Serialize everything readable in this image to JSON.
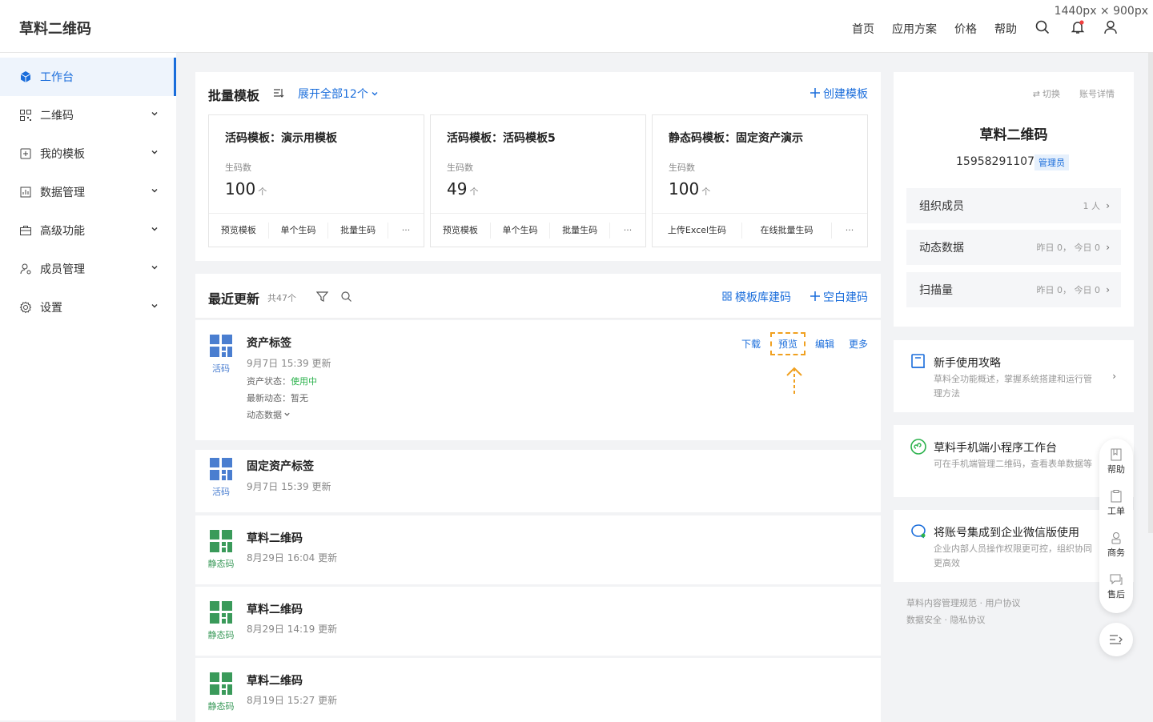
{
  "page_size_label": "1440px × 900px",
  "header": {
    "logo": "草料二维码",
    "nav": [
      "首页",
      "应用方案",
      "价格",
      "帮助"
    ]
  },
  "sidebar": {
    "items": [
      {
        "label": "工作台",
        "icon": "cube-icon",
        "active": true
      },
      {
        "label": "二维码",
        "icon": "qrcode-icon"
      },
      {
        "label": "我的模板",
        "icon": "template-icon"
      },
      {
        "label": "数据管理",
        "icon": "chart-icon"
      },
      {
        "label": "高级功能",
        "icon": "briefcase-icon"
      },
      {
        "label": "成员管理",
        "icon": "user-gear-icon"
      },
      {
        "label": "设置",
        "icon": "gear-icon"
      }
    ]
  },
  "batch": {
    "title": "批量模板",
    "expand": "展开全部12个",
    "create": "创建模板",
    "cards": [
      {
        "title": "活码模板：演示用模板",
        "label": "生码数",
        "value": "100",
        "unit": "个",
        "actions": [
          "预览模板",
          "单个生码",
          "批量生码",
          "···"
        ]
      },
      {
        "title": "活码模板：活码模板5",
        "label": "生码数",
        "value": "49",
        "unit": "个",
        "actions": [
          "预览模板",
          "单个生码",
          "批量生码",
          "···"
        ]
      },
      {
        "title": "静态码模板：固定资产演示",
        "label": "生码数",
        "value": "100",
        "unit": "个",
        "actions": [
          "上传Excel生码",
          "在线批量生码",
          "···"
        ]
      }
    ]
  },
  "recent": {
    "title": "最近更新",
    "count": "共47个",
    "links": [
      "模板库建码",
      "空白建码"
    ],
    "rows": [
      {
        "name": "资产标签",
        "type": "活码",
        "time": "9月7日 15:39 更新",
        "status_label": "资产状态：",
        "status_value": "使用中",
        "dynamic_label": "最新动态：暂无",
        "dynamic_link": "动态数据",
        "actions": [
          "下载",
          "预览",
          "编辑",
          "更多"
        ]
      },
      {
        "name": "固定资产标签",
        "type": "活码",
        "time": "9月7日 15:39 更新"
      },
      {
        "name": "草料二维码",
        "type": "静态码",
        "time": "8月29日 16:04 更新"
      },
      {
        "name": "草料二维码",
        "type": "静态码",
        "time": "8月29日 14:19 更新"
      },
      {
        "name": "草料二维码",
        "type": "静态码",
        "time": "8月19日 15:27 更新"
      }
    ]
  },
  "account": {
    "switch": "切换",
    "detail": "账号详情",
    "name": "草料二维码",
    "phone": "15958291107",
    "role": "管理员",
    "stats": [
      {
        "label": "组织成员",
        "value": "1 人"
      },
      {
        "label": "动态数据",
        "value": "昨日 0， 今日 0"
      },
      {
        "label": "扫描量",
        "value": "昨日 0， 今日 0"
      }
    ]
  },
  "guides": [
    {
      "title": "新手使用攻略",
      "desc": "草料全功能概述，掌握系统搭建和运行管理方法"
    },
    {
      "title": "草料手机端小程序工作台",
      "desc": "可在手机端管理二维码，查看表单数据等"
    },
    {
      "title": "将账号集成到企业微信版使用",
      "desc": "企业内部人员操作权限更可控，组织协同更高效"
    }
  ],
  "footer_links": [
    "草料内容管理规范",
    "用户协议",
    "数据安全",
    "隐私协议"
  ],
  "float_menu": [
    "帮助",
    "工单",
    "商务",
    "售后"
  ],
  "colors": {
    "primary": "#1a6ddb",
    "live_code": "#4a7ed0",
    "static_code": "#3a9a5a",
    "in_use": "#2bb24c",
    "highlight": "#f0a020"
  }
}
